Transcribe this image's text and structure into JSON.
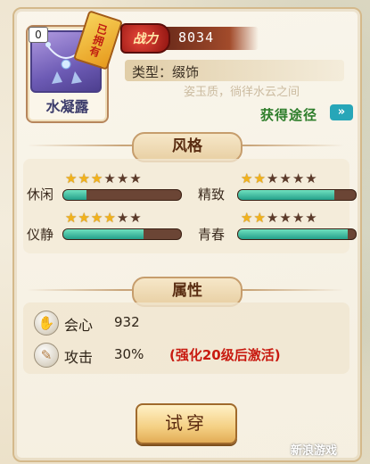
{
  "item": {
    "count": "0",
    "owned_tag": "已拥有",
    "name": "水凝露"
  },
  "power": {
    "label": "战力",
    "value": "8034"
  },
  "type_line": "类型：缀饰",
  "description_ghost": "姿玉质，徜徉水云之间",
  "obtain_link": "获得途径",
  "obtain_arrow": "»",
  "style_section": {
    "title": "风格",
    "stats": [
      {
        "label": "休闲",
        "stars": 3,
        "max_stars": 6,
        "fill": 0.2
      },
      {
        "label": "精致",
        "stars": 2,
        "max_stars": 6,
        "fill": 0.82
      },
      {
        "label": "仪静",
        "stars": 4,
        "max_stars": 6,
        "fill": 0.68
      },
      {
        "label": "青春",
        "stars": 2,
        "max_stars": 6,
        "fill": 0.93
      }
    ]
  },
  "attr_section": {
    "title": "属性",
    "attrs": [
      {
        "name": "会心",
        "value": "932",
        "note": "",
        "icon": "hand-icon"
      },
      {
        "name": "攻击",
        "value": "30%",
        "note": "(强化20级后激活)",
        "icon": "feather-icon"
      }
    ]
  },
  "try_on_label": "试穿",
  "watermark": "新浪游戏",
  "colors": {
    "bar_fill": "#24a08a",
    "star_on": "#f2b21b",
    "note_red": "#c81a10",
    "obtain_green": "#2d7d2a"
  }
}
